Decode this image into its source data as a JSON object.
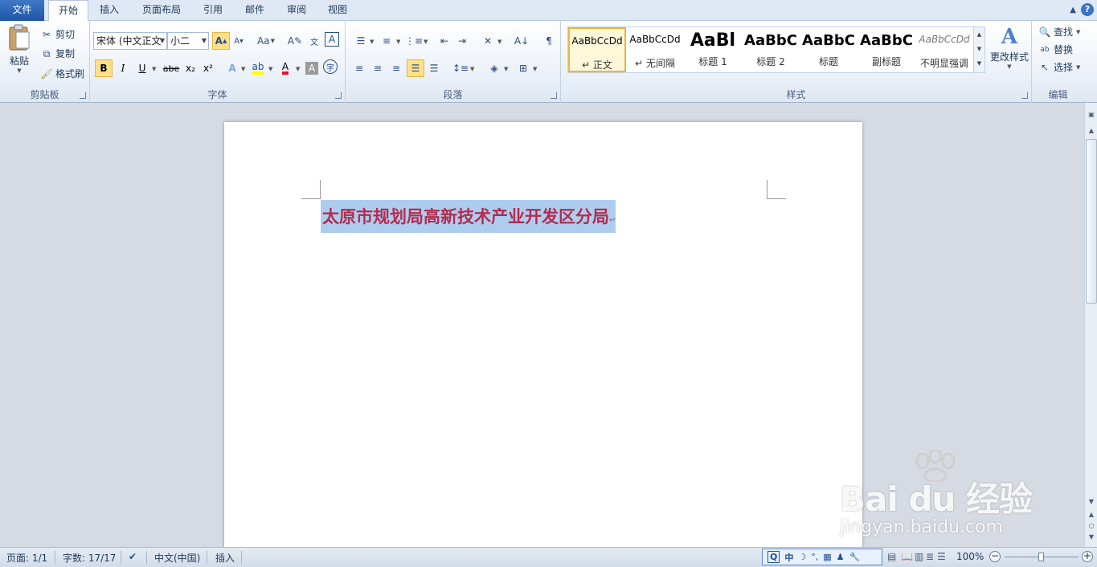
{
  "tabs": [
    {
      "label": "文件",
      "type": "file"
    },
    {
      "label": "开始",
      "type": "active"
    },
    {
      "label": "插入",
      "type": ""
    },
    {
      "label": "页面布局",
      "type": ""
    },
    {
      "label": "引用",
      "type": ""
    },
    {
      "label": "邮件",
      "type": ""
    },
    {
      "label": "审阅",
      "type": ""
    },
    {
      "label": "视图",
      "type": ""
    }
  ],
  "help_label": "?",
  "clipboard": {
    "paste": "粘贴",
    "cut": "剪切",
    "copy": "复制",
    "format_painter": "格式刷",
    "group_label": "剪贴板"
  },
  "font": {
    "font_name": "宋体 (中文正文",
    "font_size": "小二",
    "grow": "A",
    "shrink": "A",
    "change_case": "Aa",
    "bold": "B",
    "italic": "I",
    "underline": "U",
    "strike": "abe",
    "subscript": "x₂",
    "superscript": "x²",
    "group_label": "字体"
  },
  "paragraph": {
    "group_label": "段落"
  },
  "styles": {
    "group_label": "样式",
    "items": [
      {
        "sample": "AaBbCcDd",
        "name": "↵ 正文",
        "selected": true
      },
      {
        "sample": "AaBbCcDd",
        "name": "↵ 无间隔",
        "selected": false
      },
      {
        "sample": "AaBl",
        "name": "标题 1",
        "selected": false
      },
      {
        "sample": "AaBbC",
        "name": "标题 2",
        "selected": false
      },
      {
        "sample": "AaBbC",
        "name": "标题",
        "selected": false
      },
      {
        "sample": "AaBbC",
        "name": "副标题",
        "selected": false
      },
      {
        "sample": "AaBbCcDd",
        "name": "不明显强调",
        "selected": false
      }
    ],
    "change_styles": "更改样式"
  },
  "editing": {
    "find": "查找",
    "replace": "替换",
    "select": "选择",
    "group_label": "编辑"
  },
  "document": {
    "text": "太原市规划局高新技术产业开发区分局",
    "para_mark": "↵"
  },
  "watermark": {
    "brand": "Bai du 经验",
    "url": "jingyan.baidu.com"
  },
  "status": {
    "page": "页面: 1/1",
    "words": "字数: 17/17",
    "language": "中文(中国)",
    "mode": "插入",
    "ime_mode": "中",
    "zoom": "100%",
    "zoom_level": 1.0
  },
  "colors": {
    "selection": "#aecdee",
    "text": "#b42b4e",
    "file_tab": "#2a62b5"
  }
}
